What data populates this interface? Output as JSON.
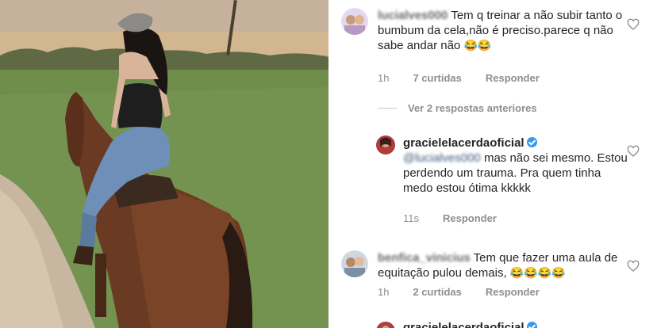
{
  "comments": [
    {
      "username": "lucialves000",
      "text": "Tem q treinar a não subir tanto o bumbum da cela,não é preciso.parece q não sabe andar não",
      "emoji": "😂😂",
      "time": "1h",
      "likes": "7 curtidas",
      "reply": "Responder"
    },
    {
      "username": "gracielelacerdaoficial",
      "mention": "@lucialves000",
      "text": " mas não sei mesmo. Estou perdendo um trauma. Pra quem tinha medo estou ótima kkkkk",
      "time": "11s",
      "reply": "Responder"
    },
    {
      "username": "benfica_vinicius",
      "text": "Tem que fazer uma aula de equitação pulou demais,",
      "emoji": "😂😂😂😂",
      "time": "1h",
      "likes": "2 curtidas",
      "reply": "Responder"
    },
    {
      "username": "gracielelacerdaoficial"
    }
  ],
  "view_replies": "Ver 2 respostas anteriores",
  "colors": {
    "verified": "#3897f0",
    "meta": "#8e8e8e",
    "text": "#262626"
  },
  "icons": {
    "like": "heart-outline-icon",
    "verified": "verified-badge-icon"
  }
}
